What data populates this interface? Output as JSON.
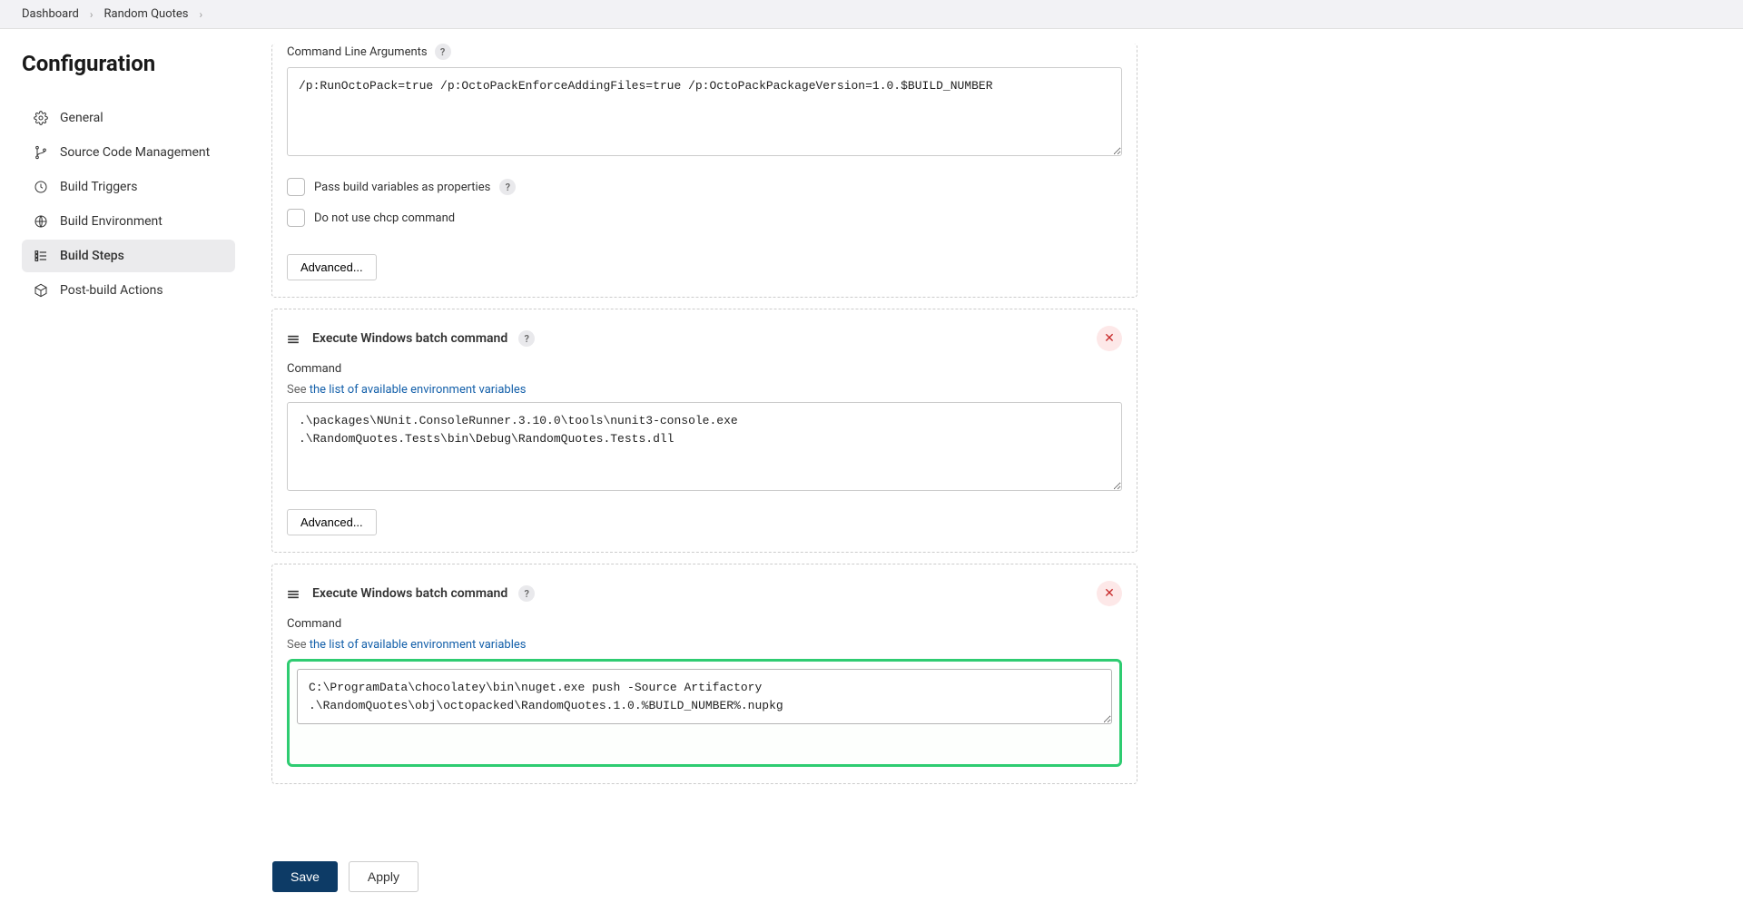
{
  "breadcrumb": {
    "items": [
      "Dashboard",
      "Random Quotes"
    ]
  },
  "sidebar": {
    "title": "Configuration",
    "items": [
      {
        "label": "General",
        "icon": "gear-icon"
      },
      {
        "label": "Source Code Management",
        "icon": "branch-icon"
      },
      {
        "label": "Build Triggers",
        "icon": "clock-icon"
      },
      {
        "label": "Build Environment",
        "icon": "globe-icon"
      },
      {
        "label": "Build Steps",
        "icon": "steps-icon",
        "active": true
      },
      {
        "label": "Post-build Actions",
        "icon": "package-icon"
      }
    ]
  },
  "step1": {
    "cmdline_label": "Command Line Arguments",
    "cmdline_value": "/p:RunOctoPack=true /p:OctoPackEnforceAddingFiles=true /p:OctoPackPackageVersion=1.0.$BUILD_NUMBER",
    "check1": "Pass build variables as properties",
    "check2": "Do not use chcp command",
    "advanced": "Advanced..."
  },
  "step2": {
    "title": "Execute Windows batch command",
    "command_label": "Command",
    "see_text": "See ",
    "link_text": "the list of available environment variables",
    "command_value": ".\\packages\\NUnit.ConsoleRunner.3.10.0\\tools\\nunit3-console.exe .\\RandomQuotes.Tests\\bin\\Debug\\RandomQuotes.Tests.dll",
    "advanced": "Advanced..."
  },
  "step3": {
    "title": "Execute Windows batch command",
    "command_label": "Command",
    "see_text": "See ",
    "link_text": "the list of available environment variables",
    "command_value": "C:\\ProgramData\\chocolatey\\bin\\nuget.exe push -Source Artifactory .\\RandomQuotes\\obj\\octopacked\\RandomQuotes.1.0.%BUILD_NUMBER%.nupkg"
  },
  "buttons": {
    "save": "Save",
    "apply": "Apply"
  }
}
